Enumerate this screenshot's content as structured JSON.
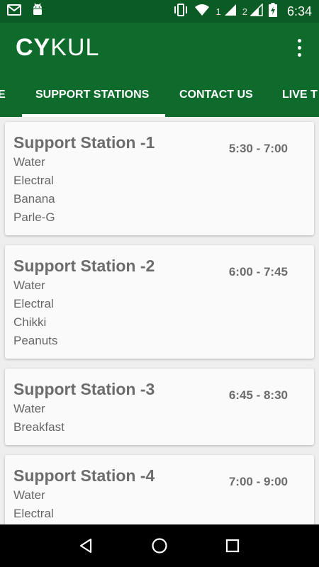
{
  "status_bar": {
    "sim1": "1",
    "sim2": "2",
    "time": "6:34",
    "icons": [
      "gmail-icon",
      "android-icon",
      "vibrate-icon",
      "wifi-icon",
      "signal-icon",
      "battery-charging-icon"
    ]
  },
  "app_bar": {
    "logo_bold": "CY",
    "logo_thin": "KUL"
  },
  "tabs": [
    {
      "label": "E"
    },
    {
      "label": "SUPPORT STATIONS",
      "selected": true
    },
    {
      "label": "CONTACT US"
    },
    {
      "label": "LIVE T"
    }
  ],
  "stations": [
    {
      "title": "Support Station -1",
      "time": "5:30 - 7:00",
      "items": [
        "Water",
        "Electral",
        "Banana",
        "Parle-G"
      ]
    },
    {
      "title": "Support Station -2",
      "time": "6:00 - 7:45",
      "items": [
        "Water",
        "Electral",
        "Chikki",
        "Peanuts"
      ]
    },
    {
      "title": "Support Station -3",
      "time": "6:45 - 8:30",
      "items": [
        "Water",
        "Breakfast"
      ]
    },
    {
      "title": "Support Station -4",
      "time": "7:00 - 9:00",
      "items": [
        "Water",
        "Electral"
      ]
    }
  ],
  "nav_bar": {
    "icons": [
      "back-icon",
      "home-icon",
      "recents-icon"
    ]
  },
  "colors": {
    "status_bar": "#0b5c24",
    "primary": "#0e6b2c",
    "card_text": "#6c6c6c"
  }
}
